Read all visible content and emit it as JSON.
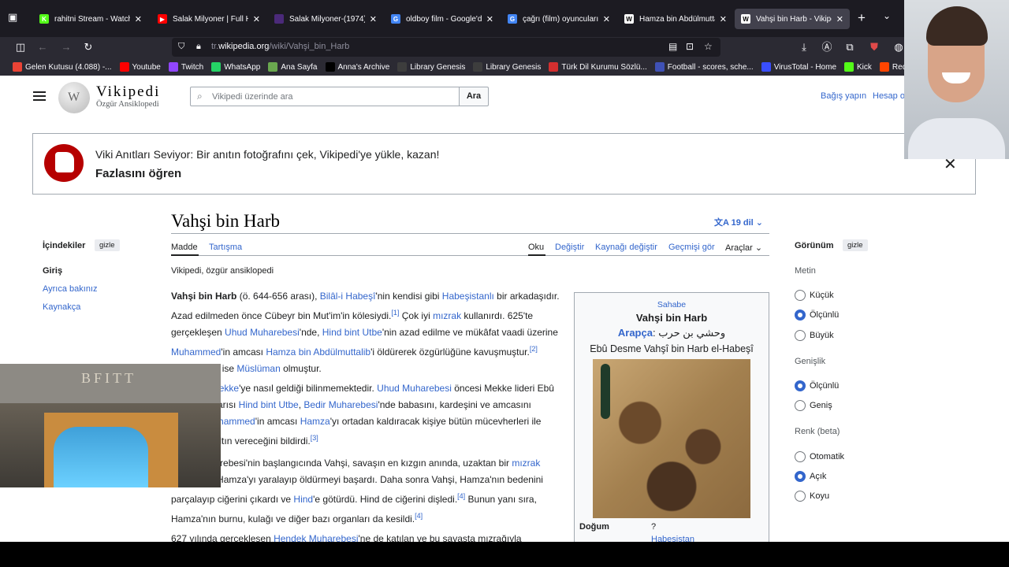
{
  "tabs": [
    {
      "title": "rahitni Stream - Watch L",
      "icon": "kick",
      "color": "#53fc18"
    },
    {
      "title": "Salak Milyoner | Full HD",
      "icon": "youtube",
      "color": "#ff0000"
    },
    {
      "title": "Salak Milyoner-(1974)Re",
      "icon": "site",
      "color": "#4b2a7a"
    },
    {
      "title": "oldboy film - Google'da",
      "icon": "google",
      "color": "#4285f4"
    },
    {
      "title": "çağrı (film) oyuncuları -",
      "icon": "google",
      "color": "#4285f4"
    },
    {
      "title": "Hamza bin Abdülmuttalı",
      "icon": "wikipedia",
      "color": "#ffffff"
    },
    {
      "title": "Vahşi bin Harb - Vikipedi",
      "icon": "wikipedia",
      "color": "#ffffff",
      "active": true
    }
  ],
  "url": {
    "prefix": "tr.",
    "domain": "wikipedia.org",
    "path": "/wiki/Vahşi_bin_Harb"
  },
  "bookmarks": [
    {
      "label": "Gelen Kutusu (4.088) -...",
      "icon": "gmail",
      "color": "#ea4335"
    },
    {
      "label": "Youtube",
      "icon": "youtube",
      "color": "#ff0000"
    },
    {
      "label": "Twitch",
      "icon": "twitch",
      "color": "#9146ff"
    },
    {
      "label": "WhatsApp",
      "icon": "whatsapp",
      "color": "#25d366"
    },
    {
      "label": "Ana Sayfa",
      "icon": "home",
      "color": "#6aa84f"
    },
    {
      "label": "Anna's Archive",
      "icon": "archive",
      "color": "#000000"
    },
    {
      "label": "Library Genesis",
      "icon": "book",
      "color": "#3d3d3d"
    },
    {
      "label": "Library Genesis",
      "icon": "book",
      "color": "#3d3d3d"
    },
    {
      "label": "Türk Dil Kurumu Sözlü...",
      "icon": "tdk",
      "color": "#d32f2f"
    },
    {
      "label": "Football - scores, sche...",
      "icon": "football",
      "color": "#3f51b5"
    },
    {
      "label": "VirusTotal - Home",
      "icon": "virustotal",
      "color": "#394eff"
    },
    {
      "label": "Kick",
      "icon": "kick",
      "color": "#53fc18"
    },
    {
      "label": "Reddit Soccer Str...",
      "icon": "reddit",
      "color": "#ff4500"
    }
  ],
  "wiki": {
    "wordmark": "Vikipedi",
    "tagline": "Özgür Ansiklopedi",
    "search_placeholder": "Vikipedi üzerinde ara",
    "search_button": "Ara",
    "donate": "Bağış yapın",
    "account": "Hesap o"
  },
  "banner": {
    "title": "Viki Anıtları Seviyor: Bir anıtın fotoğrafını çek, Vikipedi'ye yükle, kazan!",
    "link": "Fazlasını öğren"
  },
  "article": {
    "title": "Vahşi bin Harb",
    "languages": "19 dil",
    "tabs_left": [
      "Madde",
      "Tartışma"
    ],
    "tabs_right": [
      "Oku",
      "Değiştir",
      "Kaynağı değiştir",
      "Geçmişi gör",
      "Araçlar"
    ],
    "from": "Vikipedi, özgür ansiklopedi"
  },
  "toc": {
    "heading": "İçindekiler",
    "hide": "gizle",
    "items": [
      "Giriş",
      "Ayrıca bakınız",
      "Kaynakça"
    ]
  },
  "infobox": {
    "category": "Sahabe",
    "name": "Vahşi bin Harb",
    "arabic_label": "Arapça",
    "arabic": "وحشي بن حرب",
    "fullname": "Ebû Desme Vahşî bin Harb el-Habeşî",
    "birth_label": "Doğum",
    "birth_value": "?",
    "birth_place": "Habeşistan"
  },
  "appearance": {
    "heading": "Görünüm",
    "hide": "gizle",
    "text_section": "Metin",
    "text_options": [
      "Küçük",
      "Ölçünlü",
      "Büyük"
    ],
    "width_section": "Genişlik",
    "width_options": [
      "Ölçünlü",
      "Geniş"
    ],
    "color_section": "Renk (beta)",
    "color_options": [
      "Otomatik",
      "Açık",
      "Koyu"
    ]
  },
  "overlay": {
    "board_text": "BFITT"
  }
}
